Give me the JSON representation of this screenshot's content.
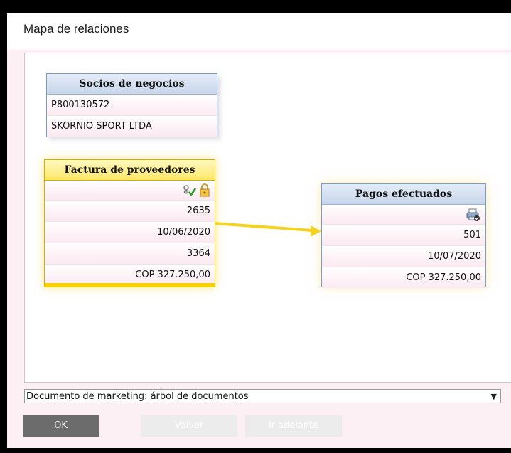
{
  "window": {
    "title": "Mapa de relaciones"
  },
  "socios": {
    "header": "Socios de negocios",
    "code": "P800130572",
    "name": "SKORNIO SPORT LTDA"
  },
  "factura": {
    "header": "Factura de proveedores",
    "icons": [
      "approved-document-icon",
      "lock-icon"
    ],
    "number": "2635",
    "date": "10/06/2020",
    "reference": "3364",
    "amount": "COP 327.250,00"
  },
  "pagos": {
    "header": "Pagos efectuados",
    "icons": [
      "printer-icon"
    ],
    "number": "501",
    "date": "10/07/2020",
    "amount": "COP 327.250,00"
  },
  "dropdown": {
    "selected": "Documento de marketing: árbol de documentos"
  },
  "buttons": {
    "ok": "OK",
    "volver": "Volver",
    "adelante": "Ir adelante"
  },
  "colors": {
    "accent_yellow": "#f5d200",
    "card_blue": "#7a9bc8",
    "background_pink": "#fdf0f5"
  }
}
